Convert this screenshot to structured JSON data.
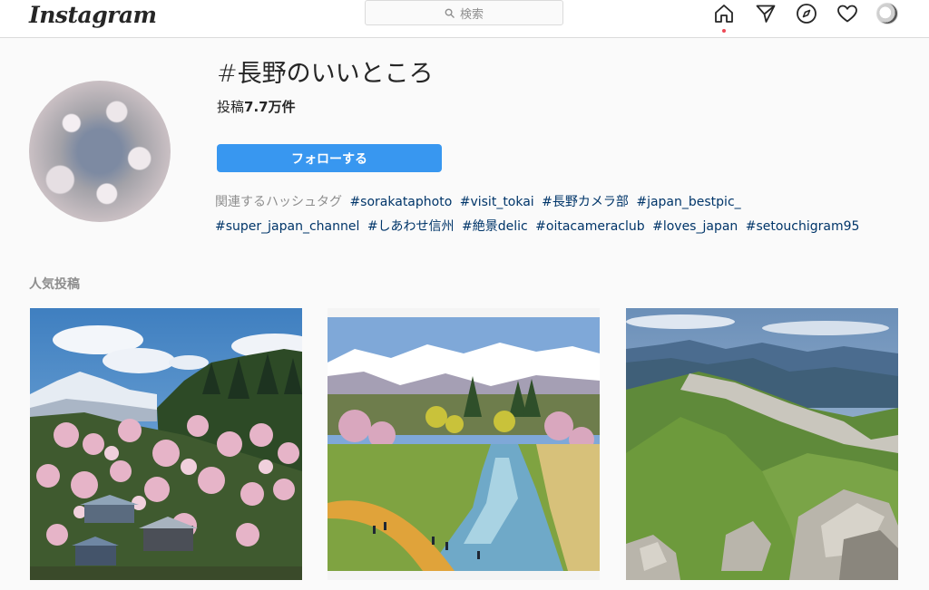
{
  "header": {
    "logo": "Instagram",
    "search_placeholder": "検索",
    "icons": [
      "home-icon",
      "direct-send-icon",
      "compass-icon",
      "heart-icon",
      "profile-avatar"
    ],
    "notification_dot_color": "#ed4956"
  },
  "hashtag": {
    "title": "#長野のいいところ",
    "posts_label": "投稿",
    "posts_count": "7.7万件",
    "follow_label": "フォローする",
    "related_label": "関連するハッシュタグ",
    "related_tags": [
      "#sorakataphoto",
      "#visit_tokai",
      "#長野カメラ部",
      "#japan_bestpic_",
      "#super_japan_channel",
      "#しあわせ信州",
      "#絶景delic",
      "#oitacameraclub",
      "#loves_japan",
      "#setouchigram95"
    ]
  },
  "top_posts": {
    "title": "人気投稿",
    "posts": [
      {
        "subject": "village-cherry-blossom-snow-mountain-photo"
      },
      {
        "subject": "river-snow-mountains-cherry-trees-photo"
      },
      {
        "subject": "mountain-ridge-rocks-photo"
      }
    ]
  },
  "colors": {
    "accent": "#3897f0",
    "link": "#003569",
    "muted": "#8e8e8e",
    "border": "#dbdbdb",
    "background": "#fafafa"
  }
}
